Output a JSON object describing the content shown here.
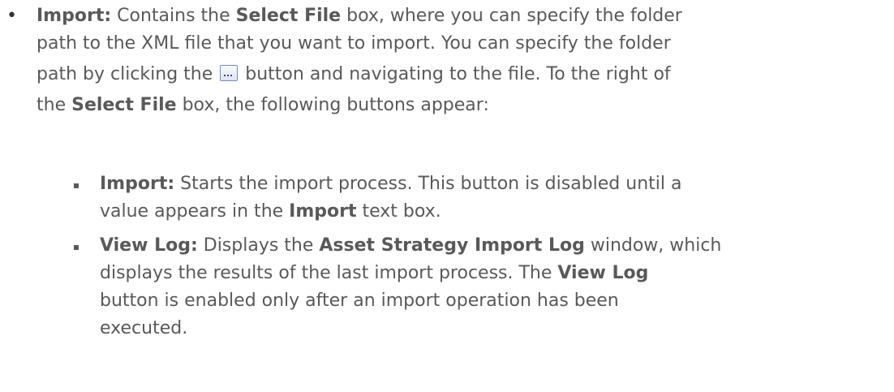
{
  "main_item": {
    "bullet": "•",
    "term": "Import:",
    "line1_a": "Contains the ",
    "line1_b": "Select File",
    "line1_c": " box, where you can specify the folder",
    "line2": "path to the XML file that you want to import. You can specify the folder",
    "line3_a": "path by clicking the ",
    "browse_button_icon": "ellipsis-browse-icon",
    "line3_b": " button and navigating to the file. To the right of",
    "line4_a": "the ",
    "line4_b": "Select File",
    "line4_c": " box, the following buttons appear:"
  },
  "sub_items": [
    {
      "term": "Import:",
      "line1": " Starts the import process. This button is disabled until a",
      "line2_a": "value appears in the ",
      "line2_b": "Import",
      "line2_c": " text box."
    },
    {
      "term": "View Log:",
      "line1_a": " Displays the ",
      "line1_b": "Asset Strategy Import Log",
      "line1_c": " window, which",
      "line2_a": "displays the results of the last import process. The ",
      "line2_b": "View Log",
      "line3": "button is enabled only after an import operation has been",
      "line4": "executed."
    }
  ]
}
